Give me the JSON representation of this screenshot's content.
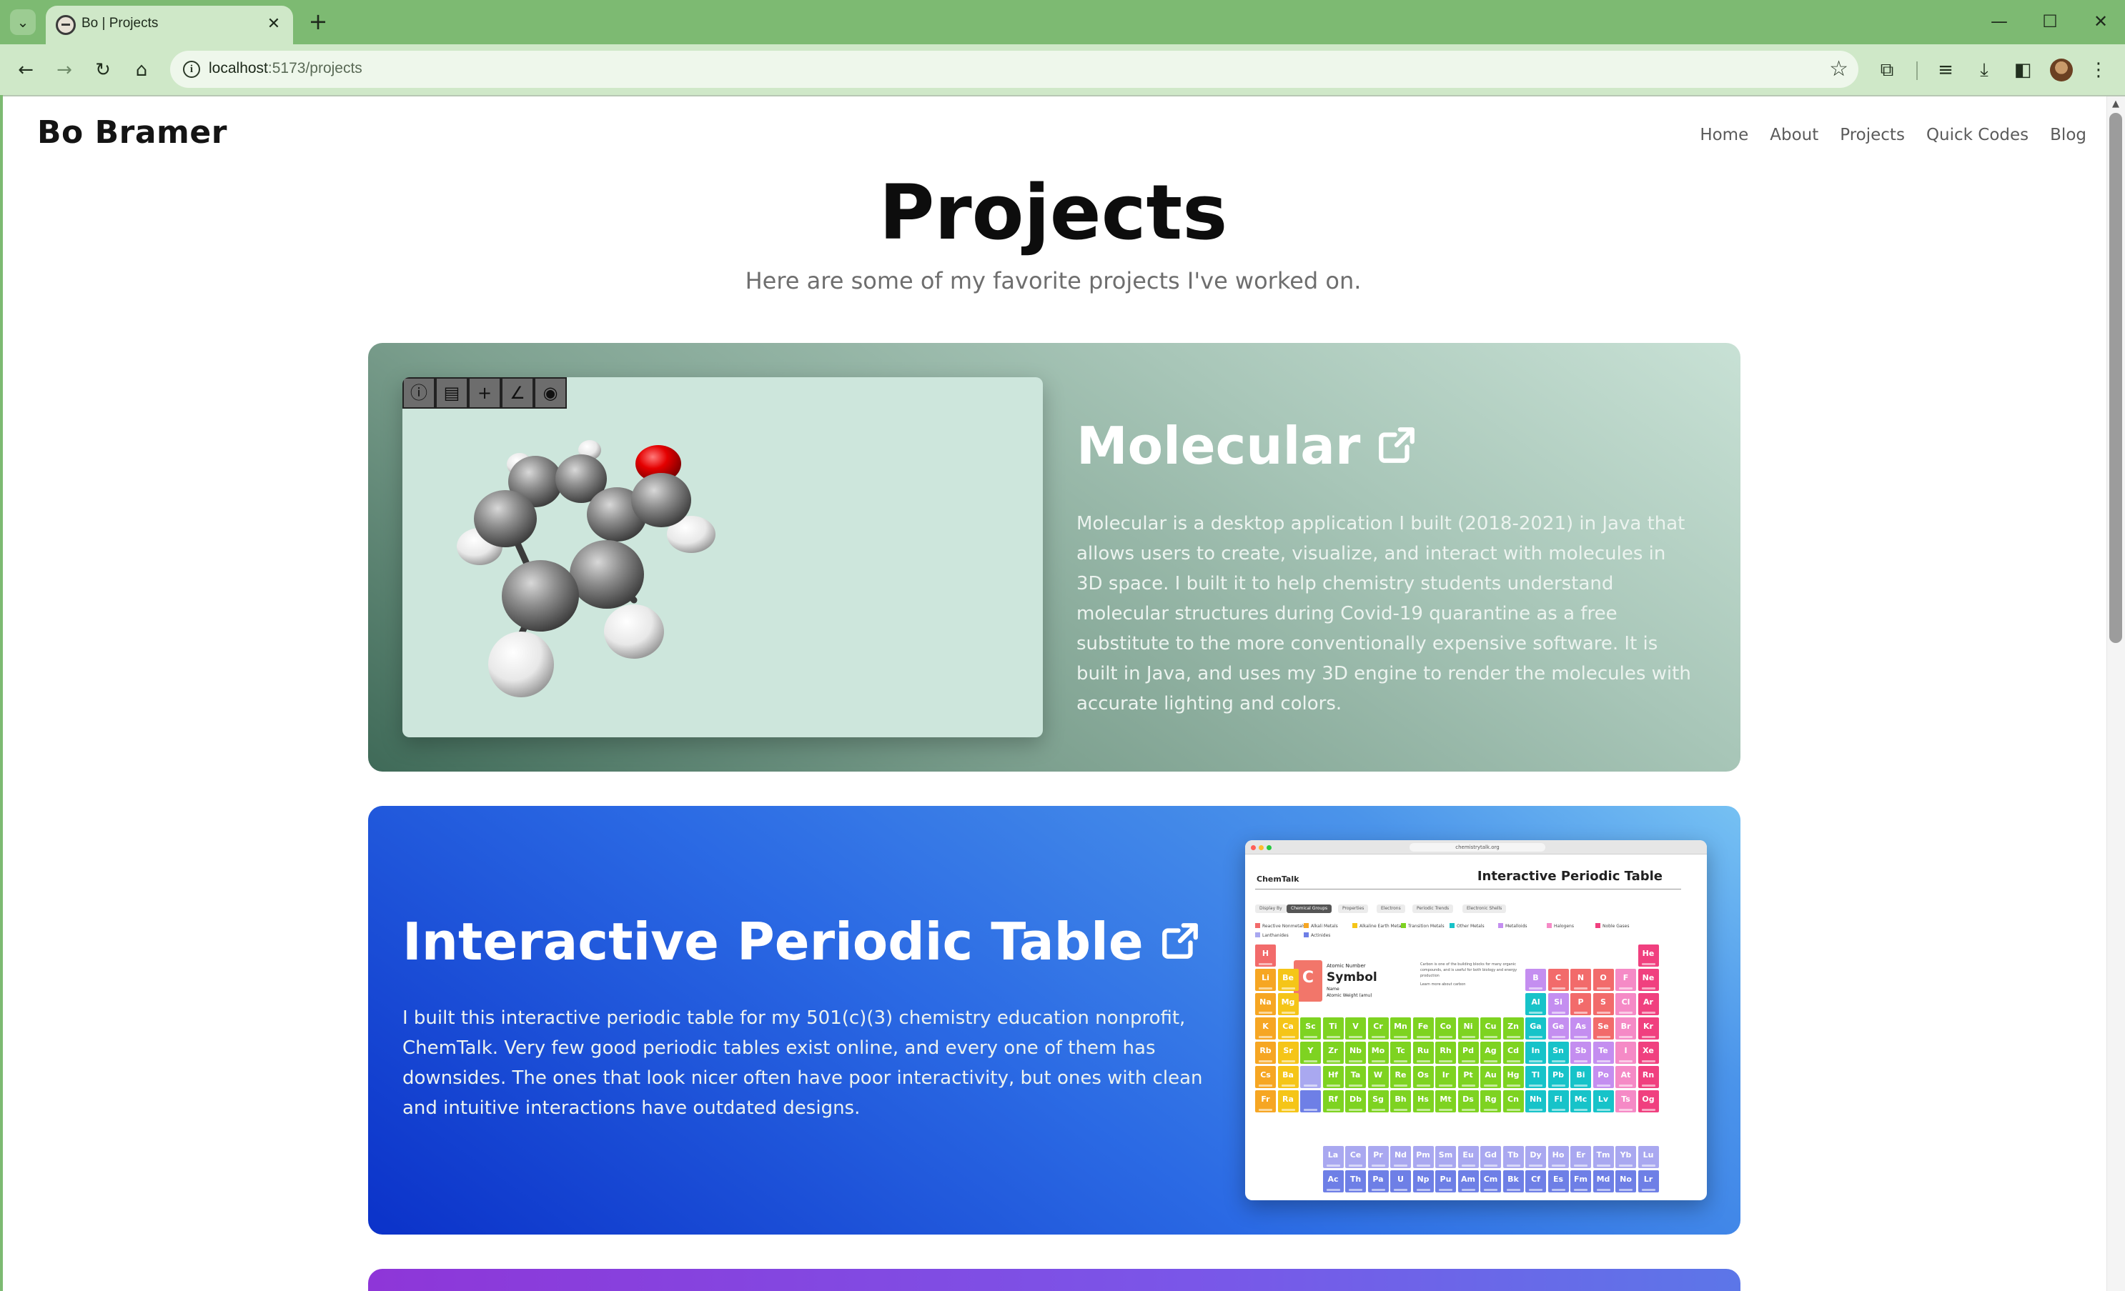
{
  "browser": {
    "tab_title": "Bo | Projects",
    "url_host": "localhost",
    "url_path": ":5173/projects"
  },
  "site": {
    "logo": "Bo Bramer",
    "nav": [
      "Home",
      "About",
      "Projects",
      "Quick Codes",
      "Blog"
    ]
  },
  "page": {
    "title": "Projects",
    "subtitle": "Here are some of my favorite projects I've worked on."
  },
  "projects": [
    {
      "title": "Molecular",
      "description": "Molecular is a desktop application I built (2018-2021) in Java that allows users to create, visualize, and interact with molecules in 3D space. I built it to help chemistry students understand molecular structures during Covid-19 quarantine as a free substitute to the more conventionally expensive software. It is built in Java, and uses my 3D engine to render the molecules with accurate lighting and colors."
    },
    {
      "title": "Interactive Periodic Table",
      "description": "I built this interactive periodic table for my 501(c)(3) chemistry education nonprofit, ChemTalk. Very few good periodic tables exist online, and every one of them has downsides. The ones that look nicer often have poor interactivity, but ones with clean and intuitive interactions have outdated designs."
    }
  ],
  "periodic_screenshot": {
    "address": "chemistrytalk.org",
    "logo": "ChemTalk",
    "title": "Interactive Periodic Table",
    "filters": [
      "Display By",
      "Chemical Groups",
      "Properties",
      "Electrons",
      "Periodic Trends",
      "Electronic Shells"
    ],
    "legend": [
      "Reactive Nonmetals",
      "Alkali Metals",
      "Alkaline Earth Metals",
      "Transition Metals",
      "Other Metals",
      "Metalloids",
      "Halogens",
      "Noble Gases",
      "Lanthanides",
      "Actinides"
    ],
    "legend_colors": [
      "#f26b6b",
      "#f6a623",
      "#f5c518",
      "#7ed321",
      "#17c3c9",
      "#c48ef0",
      "#f58ac6",
      "#f0407f",
      "#a9a8f0",
      "#6e7fe6"
    ],
    "featured": {
      "symbol": "C",
      "atomic_number_label": "Atomic Number",
      "symbol_label": "Symbol",
      "name_label": "Name",
      "weight_label": "Atomic Weight (amu)",
      "note": "Carbon is one of the building blocks for many organic compounds, and is useful for both biology and energy production",
      "learn_more": "Learn more about carbon"
    }
  }
}
